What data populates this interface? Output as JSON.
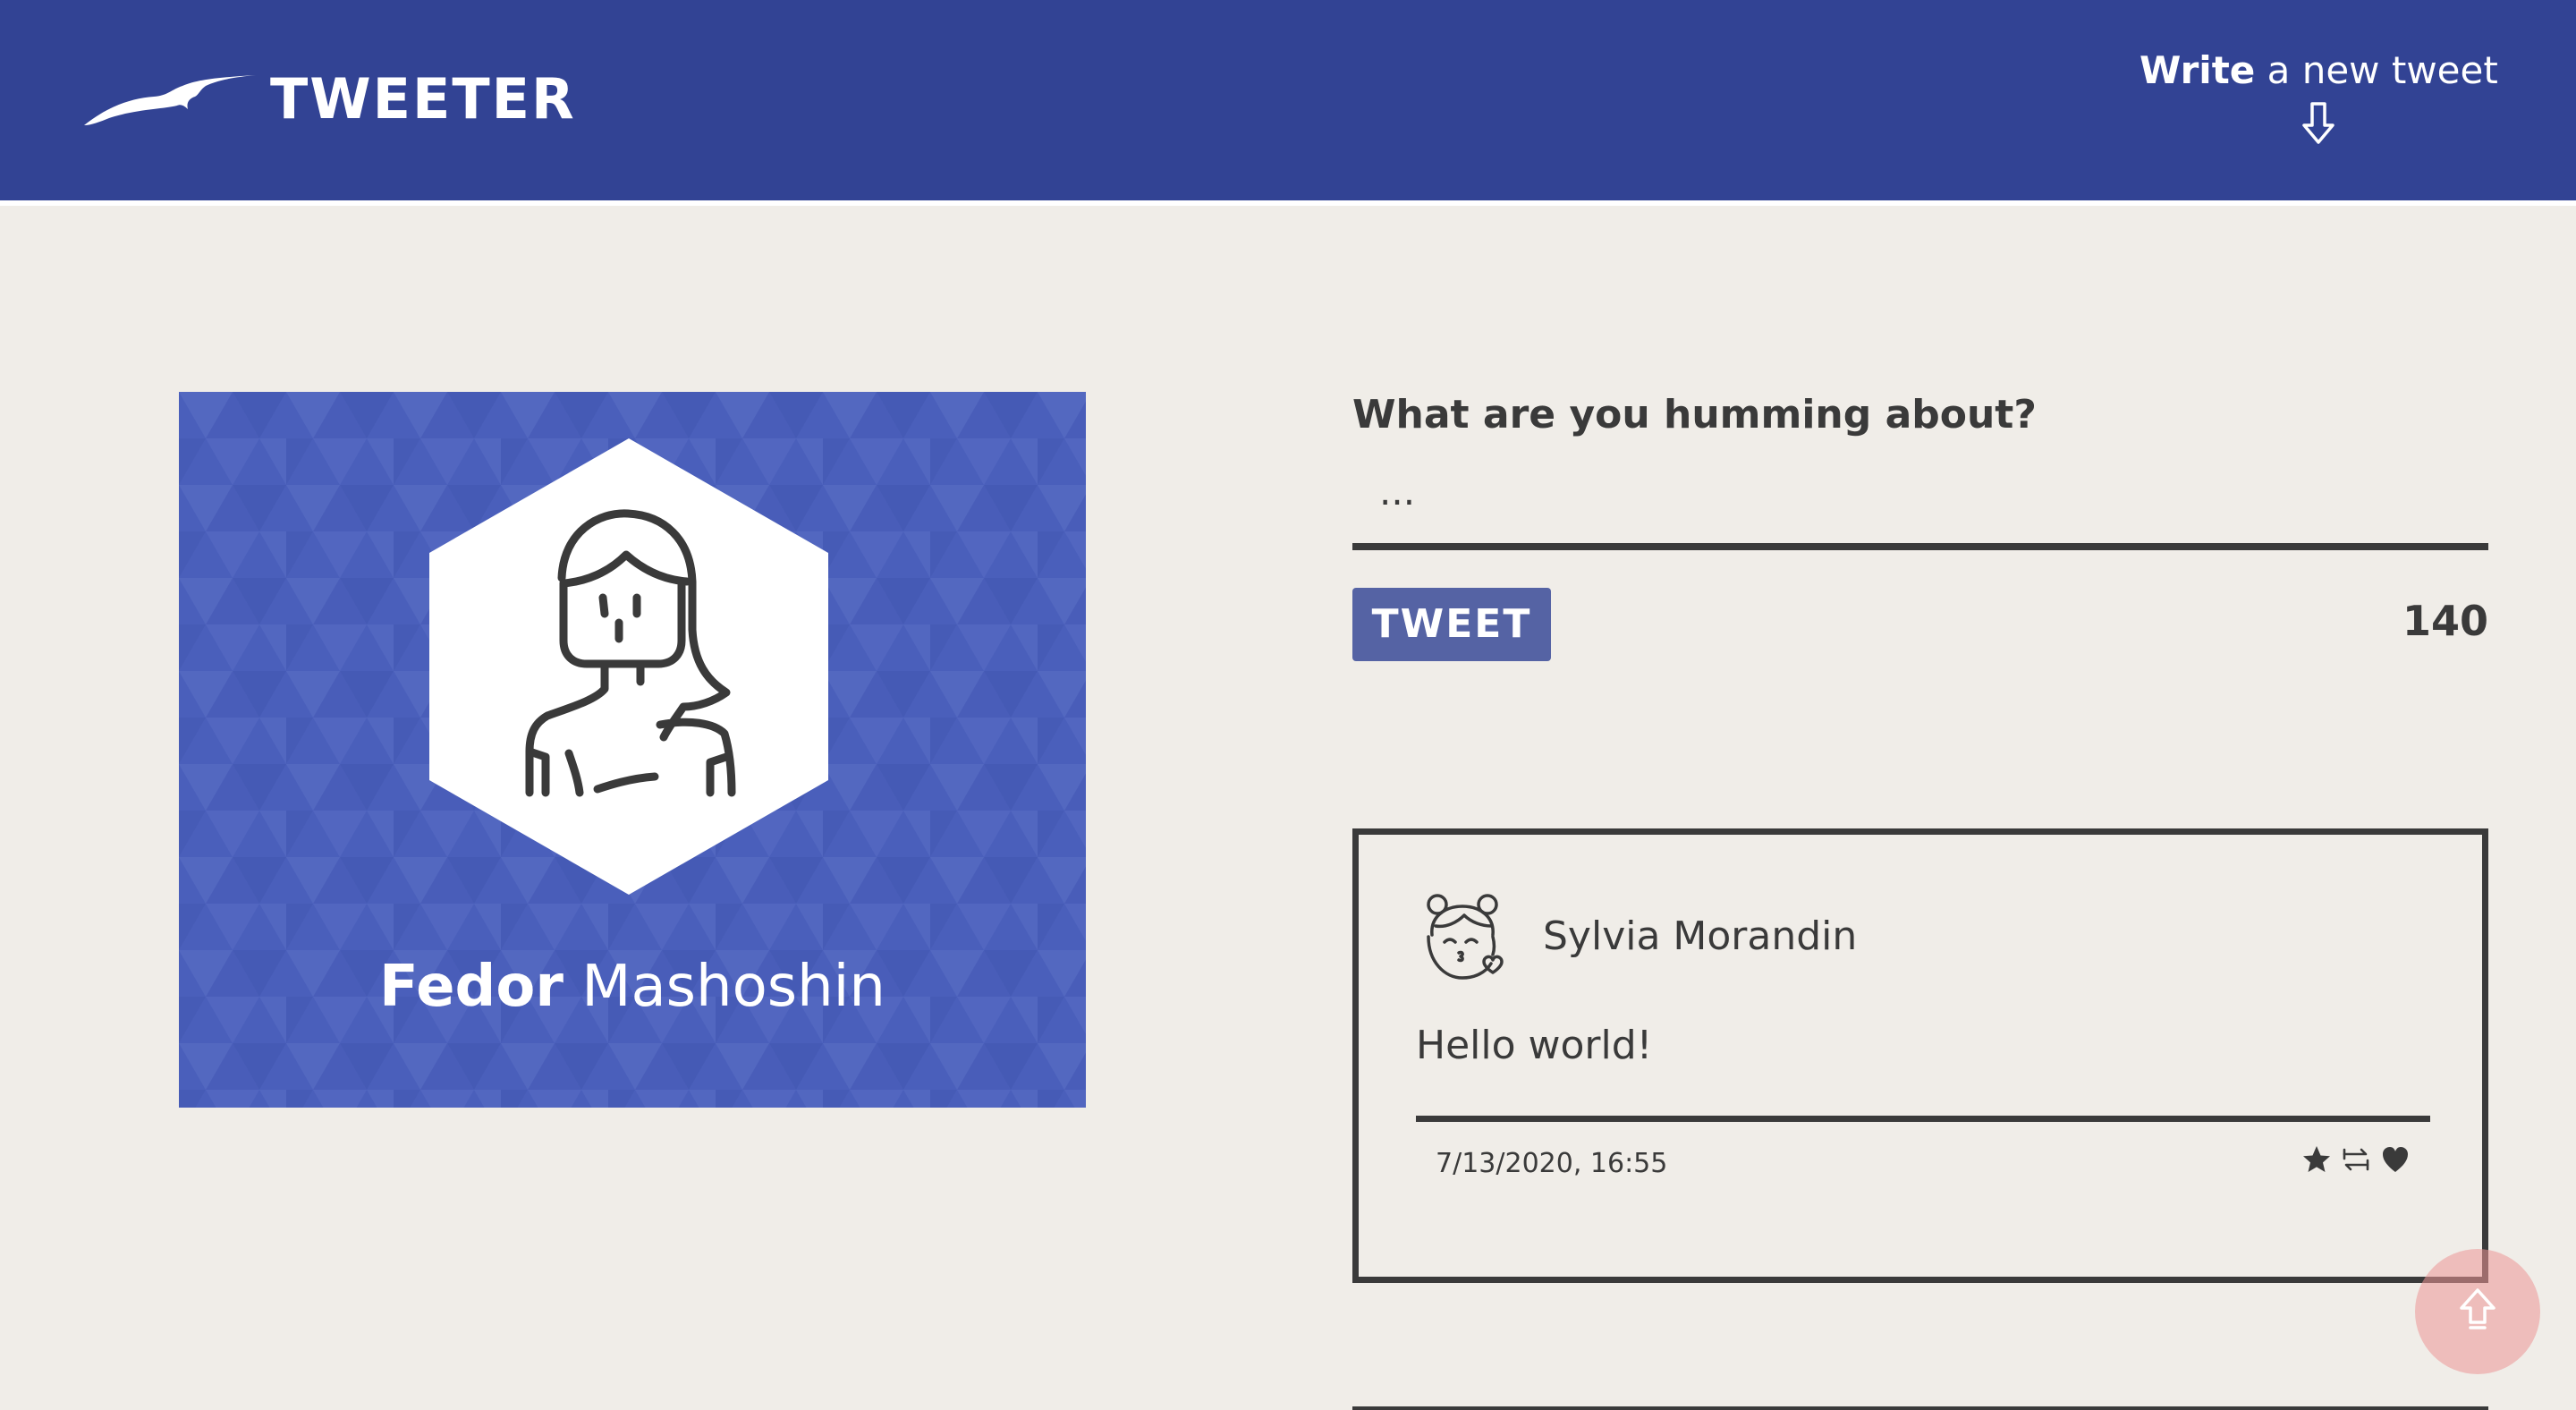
{
  "header": {
    "logo_text": "TWEETER",
    "compose_toggle": {
      "bold": "Write",
      "rest": " a new tweet"
    }
  },
  "icons": {
    "logo": "bird-icon",
    "compose_toggle": "arrow-down-icon",
    "scroll_top": "arrow-up-icon",
    "actions": [
      "star-icon",
      "retweet-icon",
      "heart-icon"
    ]
  },
  "profile": {
    "first_name": "Fedor",
    "last_name": " Mashoshin"
  },
  "compose": {
    "heading": "What are you humming about?",
    "placeholder": "...",
    "button_label": "TWEET",
    "char_count": "140"
  },
  "tweet": {
    "author": "Sylvia Morandin",
    "body": "Hello world!",
    "timestamp": "7/13/2020, 16:55"
  },
  "colors": {
    "header_bg": "#324394",
    "page_bg": "#f0ede8",
    "profile_bg": "#4a5fbb",
    "button_bg": "#5563a4",
    "text": "#3a3a3a",
    "scroll_button": "#ec9696"
  }
}
